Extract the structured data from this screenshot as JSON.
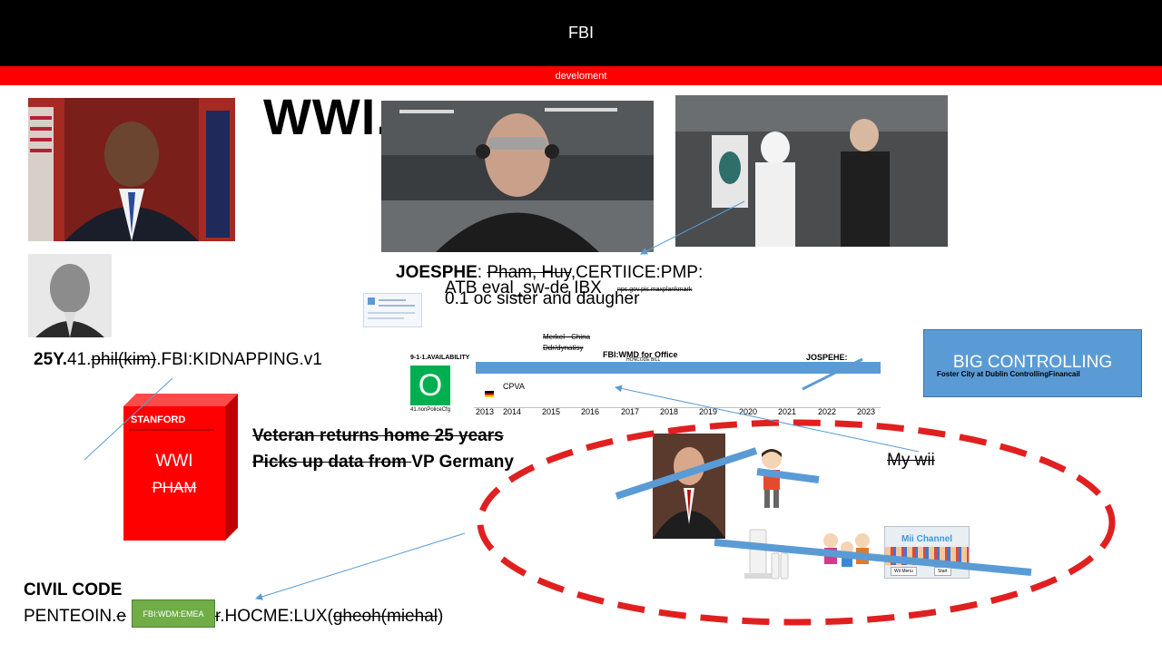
{
  "header": {
    "title": "FBI",
    "subtitle": "develoment"
  },
  "big_label": "WWI.",
  "joesphe_line": {
    "name": "JOESPHE",
    "colon": ": ",
    "struck": "Pham, Huy",
    "rest": ",CERTIICE:PMP:",
    "overlap1": "ATB eval_sw-de IBX",
    "overlap2": "0.1 oc sister and daugher",
    "tiny": "nps.gov.pis.maxplankmark"
  },
  "kidnap_line": {
    "bold": "25Y.",
    "normal1": "41.",
    "struck": "phil(kim)",
    "normal2": ".FBI:KIDNAPPING.v1"
  },
  "stanford_box": {
    "label": "STANFORD",
    "line1": "WWI",
    "line2": "PHAM"
  },
  "veteran": {
    "line1": "Veteran returns home 25 years",
    "line2_struck": "Picks up data from ",
    "line2_rest": "VP Germany"
  },
  "timeline": {
    "merkel": "Merkel - China",
    "ddr": "Ddr/dynatisy",
    "availability": "9-1-1.AVAILABILITY",
    "circle_letter": "O",
    "nonpolice": "41.nonPoliceCfg",
    "wmd_title": "FBI:WMD for Office",
    "wmd_sub": "HONCODE BILL",
    "cpva": "CPVA",
    "jospehe": "JOSPEHE:",
    "years": [
      "2013",
      "2014",
      "2015",
      "2016",
      "2017",
      "2018",
      "2019",
      "2020",
      "2021",
      "2022",
      "2023"
    ]
  },
  "big_controlling": {
    "title": "BIG CONTROLLING",
    "sub": "Foster City at Dublin ControllingFinancail"
  },
  "my_wii": "My wii",
  "mii_channel": {
    "title": "Mii Channel",
    "btn1": "Wii Menu",
    "btn2": "Start"
  },
  "civil_code": {
    "title": "CIVIL CODE",
    "p1": "PENTEOIN.",
    "p1_struck": "e",
    "p2_struck": "r",
    "p2": ".HOCME:LUX(",
    "p3_struck": "gheoh(miehal",
    "p3": ")",
    "green_tag": "FBI:WDM:EMEA"
  },
  "colors": {
    "header_bg": "#000000",
    "red_bar": "#ff0000",
    "accent_blue": "#5b9bd5",
    "ellipse_red": "#e02020",
    "tag_green": "#70ad47"
  }
}
